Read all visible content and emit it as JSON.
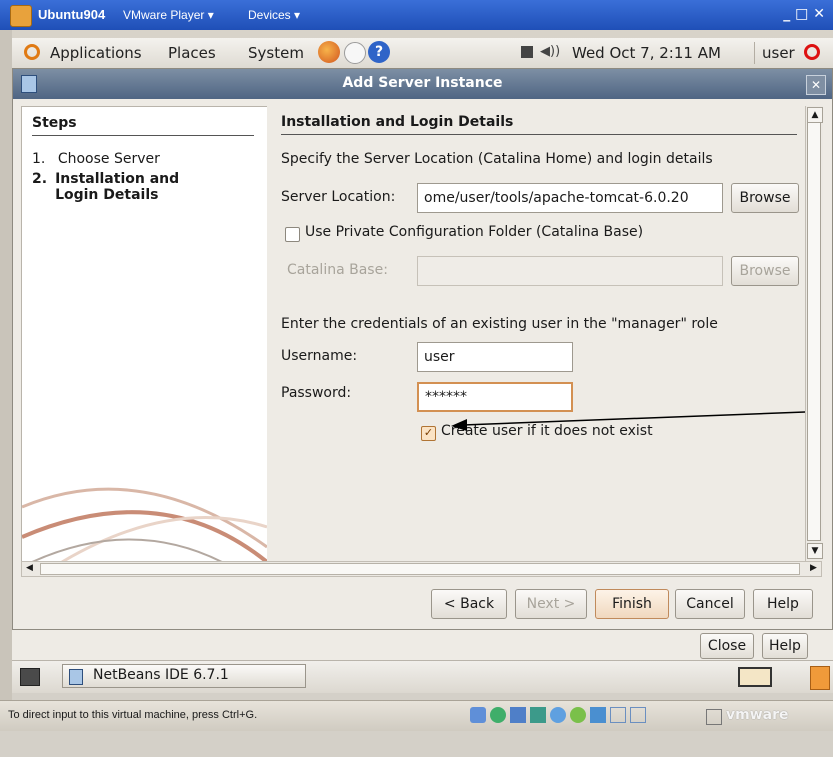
{
  "vm": {
    "title": "Ubuntu904",
    "menu_player": "VMware Player ▾",
    "menu_devices": "Devices ▾",
    "window_controls": "_ □ ✕"
  },
  "panel": {
    "applications": "Applications",
    "places": "Places",
    "system": "System",
    "clock": "Wed Oct  7,  2:11 AM",
    "user": "user"
  },
  "dialog": {
    "title": "Add Server Instance",
    "steps": {
      "heading": "Steps",
      "items": [
        {
          "num": "1.",
          "label": "Choose Server"
        },
        {
          "num": "2.",
          "label": "Installation and Login Details"
        }
      ]
    },
    "main": {
      "heading": "Installation and Login Details",
      "intro": "Specify the Server Location (Catalina Home) and login details",
      "server_location_label": "Server Location:",
      "server_location_value": "ome/user/tools/apache-tomcat-6.0.20",
      "browse_1": "Browse",
      "private_config_label": "Use Private Configuration Folder (Catalina Base)",
      "catalina_base_label": "Catalina Base:",
      "catalina_base_value": "",
      "browse_2": "Browse",
      "credentials_text": "Enter the credentials of an existing user in the \"manager\" role",
      "username_label": "Username:",
      "username_value": "user",
      "password_label": "Password:",
      "password_value": "******",
      "create_user_label": "Create user if it does not exist",
      "create_user_checked": true
    },
    "buttons": {
      "back": "< Back",
      "next": "Next >",
      "finish": "Finish",
      "cancel": "Cancel",
      "help": "Help"
    },
    "outer_buttons": {
      "close": "Close",
      "help": "Help"
    }
  },
  "taskbar": {
    "window_item": "NetBeans IDE 6.7.1"
  },
  "status": {
    "hint": "To direct input to this virtual machine, press Ctrl+G.",
    "brand": "vmware"
  }
}
